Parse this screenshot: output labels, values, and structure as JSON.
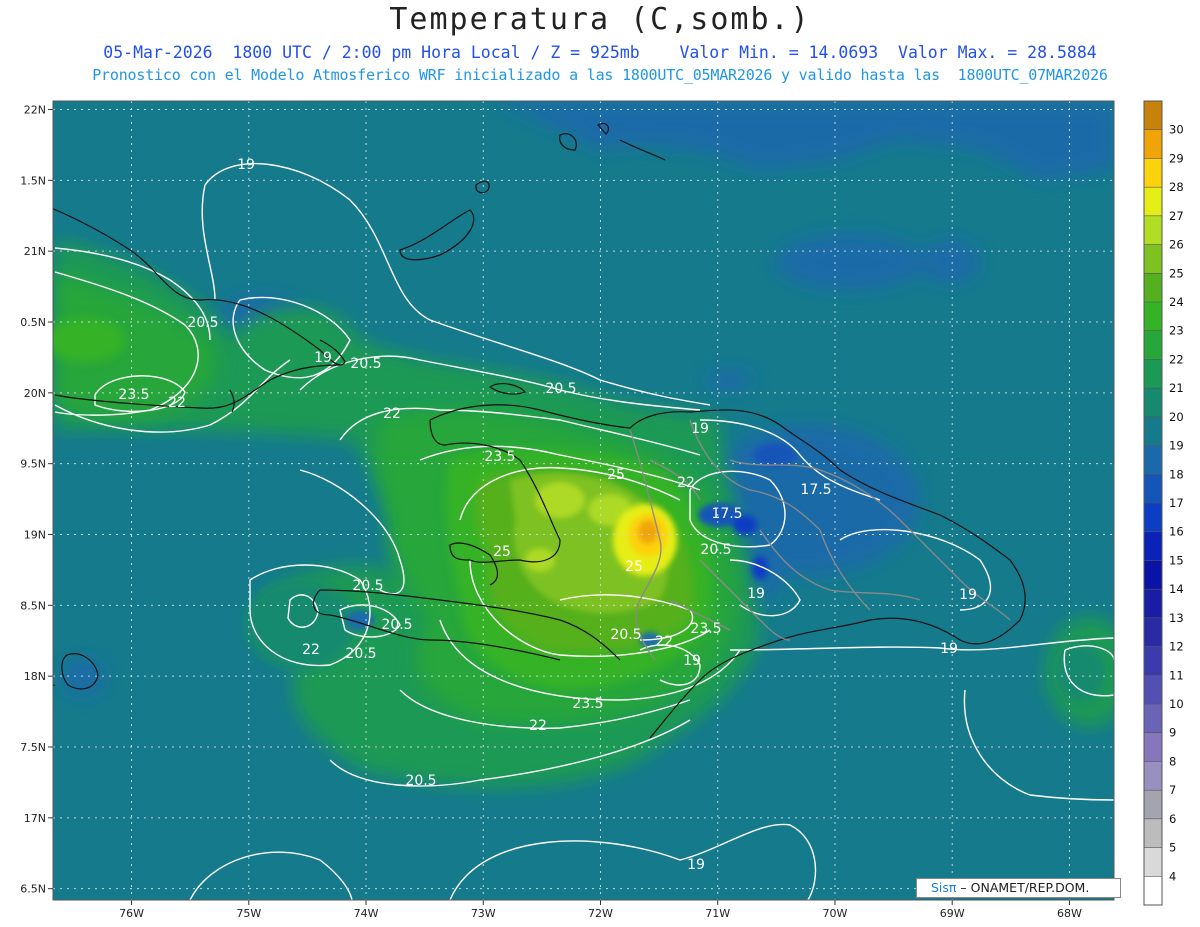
{
  "header": {
    "title": "Temperatura (C,somb.)",
    "line1": "05-Mar-2026  1800 UTC / 2:00 pm Hora Local / Z = 925mb    Valor Min. = 14.0693  Valor Max. = 28.5884",
    "line2": "Pronostico con el Modelo Atmosferico WRF inicializado a las 1800UTC_05MAR2026 y valido hasta las  1800UTC_07MAR2026"
  },
  "credit": {
    "logo": "Sisπ",
    "text": " – ONAMET/REP.DOM."
  },
  "chart_data": {
    "type": "heatmap",
    "title": "Temperatura (C,somb.)",
    "variable": "Temperature at 925mb (C)",
    "value_min": 14.0693,
    "value_max": 28.5884,
    "x_axis": {
      "ticks": [
        -76,
        -75,
        -74,
        -73,
        -72,
        -71,
        -70,
        -69,
        -68
      ],
      "tick_labels": [
        "76W",
        "75W",
        "74W",
        "73W",
        "72W",
        "71W",
        "70W",
        "69W",
        "68W"
      ],
      "range": [
        -76.67,
        -67.62
      ]
    },
    "y_axis": {
      "ticks": [
        16.5,
        17,
        17.5,
        18,
        18.5,
        19,
        19.5,
        20,
        20.5,
        21,
        21.5,
        22
      ],
      "tick_labels": [
        "6.5N",
        "17N",
        "7.5N",
        "18N",
        "8.5N",
        "19N",
        "9.5N",
        "20N",
        "0.5N",
        "21N",
        "1.5N",
        "22N"
      ],
      "range": [
        16.42,
        22.06
      ]
    },
    "grid": true,
    "colorbar": {
      "labels": [
        "4",
        "5",
        "6",
        "7",
        "8",
        "9",
        "10",
        "11",
        "12",
        "13",
        "14",
        "15",
        "16",
        "17",
        "18",
        "19",
        "20",
        "21",
        "22",
        "23",
        "24",
        "25",
        "26",
        "27",
        "28",
        "29",
        "30"
      ],
      "colors": [
        "#ffffff",
        "#d9d9d9",
        "#bcbcbc",
        "#a4a4b0",
        "#9890c0",
        "#8677bd",
        "#6a63b6",
        "#5350b3",
        "#3b3bad",
        "#2a2aa5",
        "#1a1ca3",
        "#0b12a6",
        "#0a22b8",
        "#0c3ec4",
        "#1555b8",
        "#1a6aaa",
        "#157a8c",
        "#158a6e",
        "#1b9955",
        "#27a63a",
        "#36b227",
        "#55b01f",
        "#7ec120",
        "#b2dd25",
        "#e6ee18",
        "#fcd20c",
        "#f0a408",
        "#c7820b"
      ]
    },
    "contour_labels": [
      "19",
      "20.5",
      "19",
      "20.5",
      "23.5",
      "22",
      "22",
      "20.5",
      "19",
      "23.5",
      "25",
      "22",
      "17.5",
      "17.5",
      "25",
      "20.5",
      "25",
      "19",
      "19",
      "20.5",
      "20.5",
      "22",
      "20.5",
      "20.5",
      "22",
      "23.5",
      "19",
      "19",
      "23.5",
      "22",
      "20.5",
      "19"
    ]
  }
}
